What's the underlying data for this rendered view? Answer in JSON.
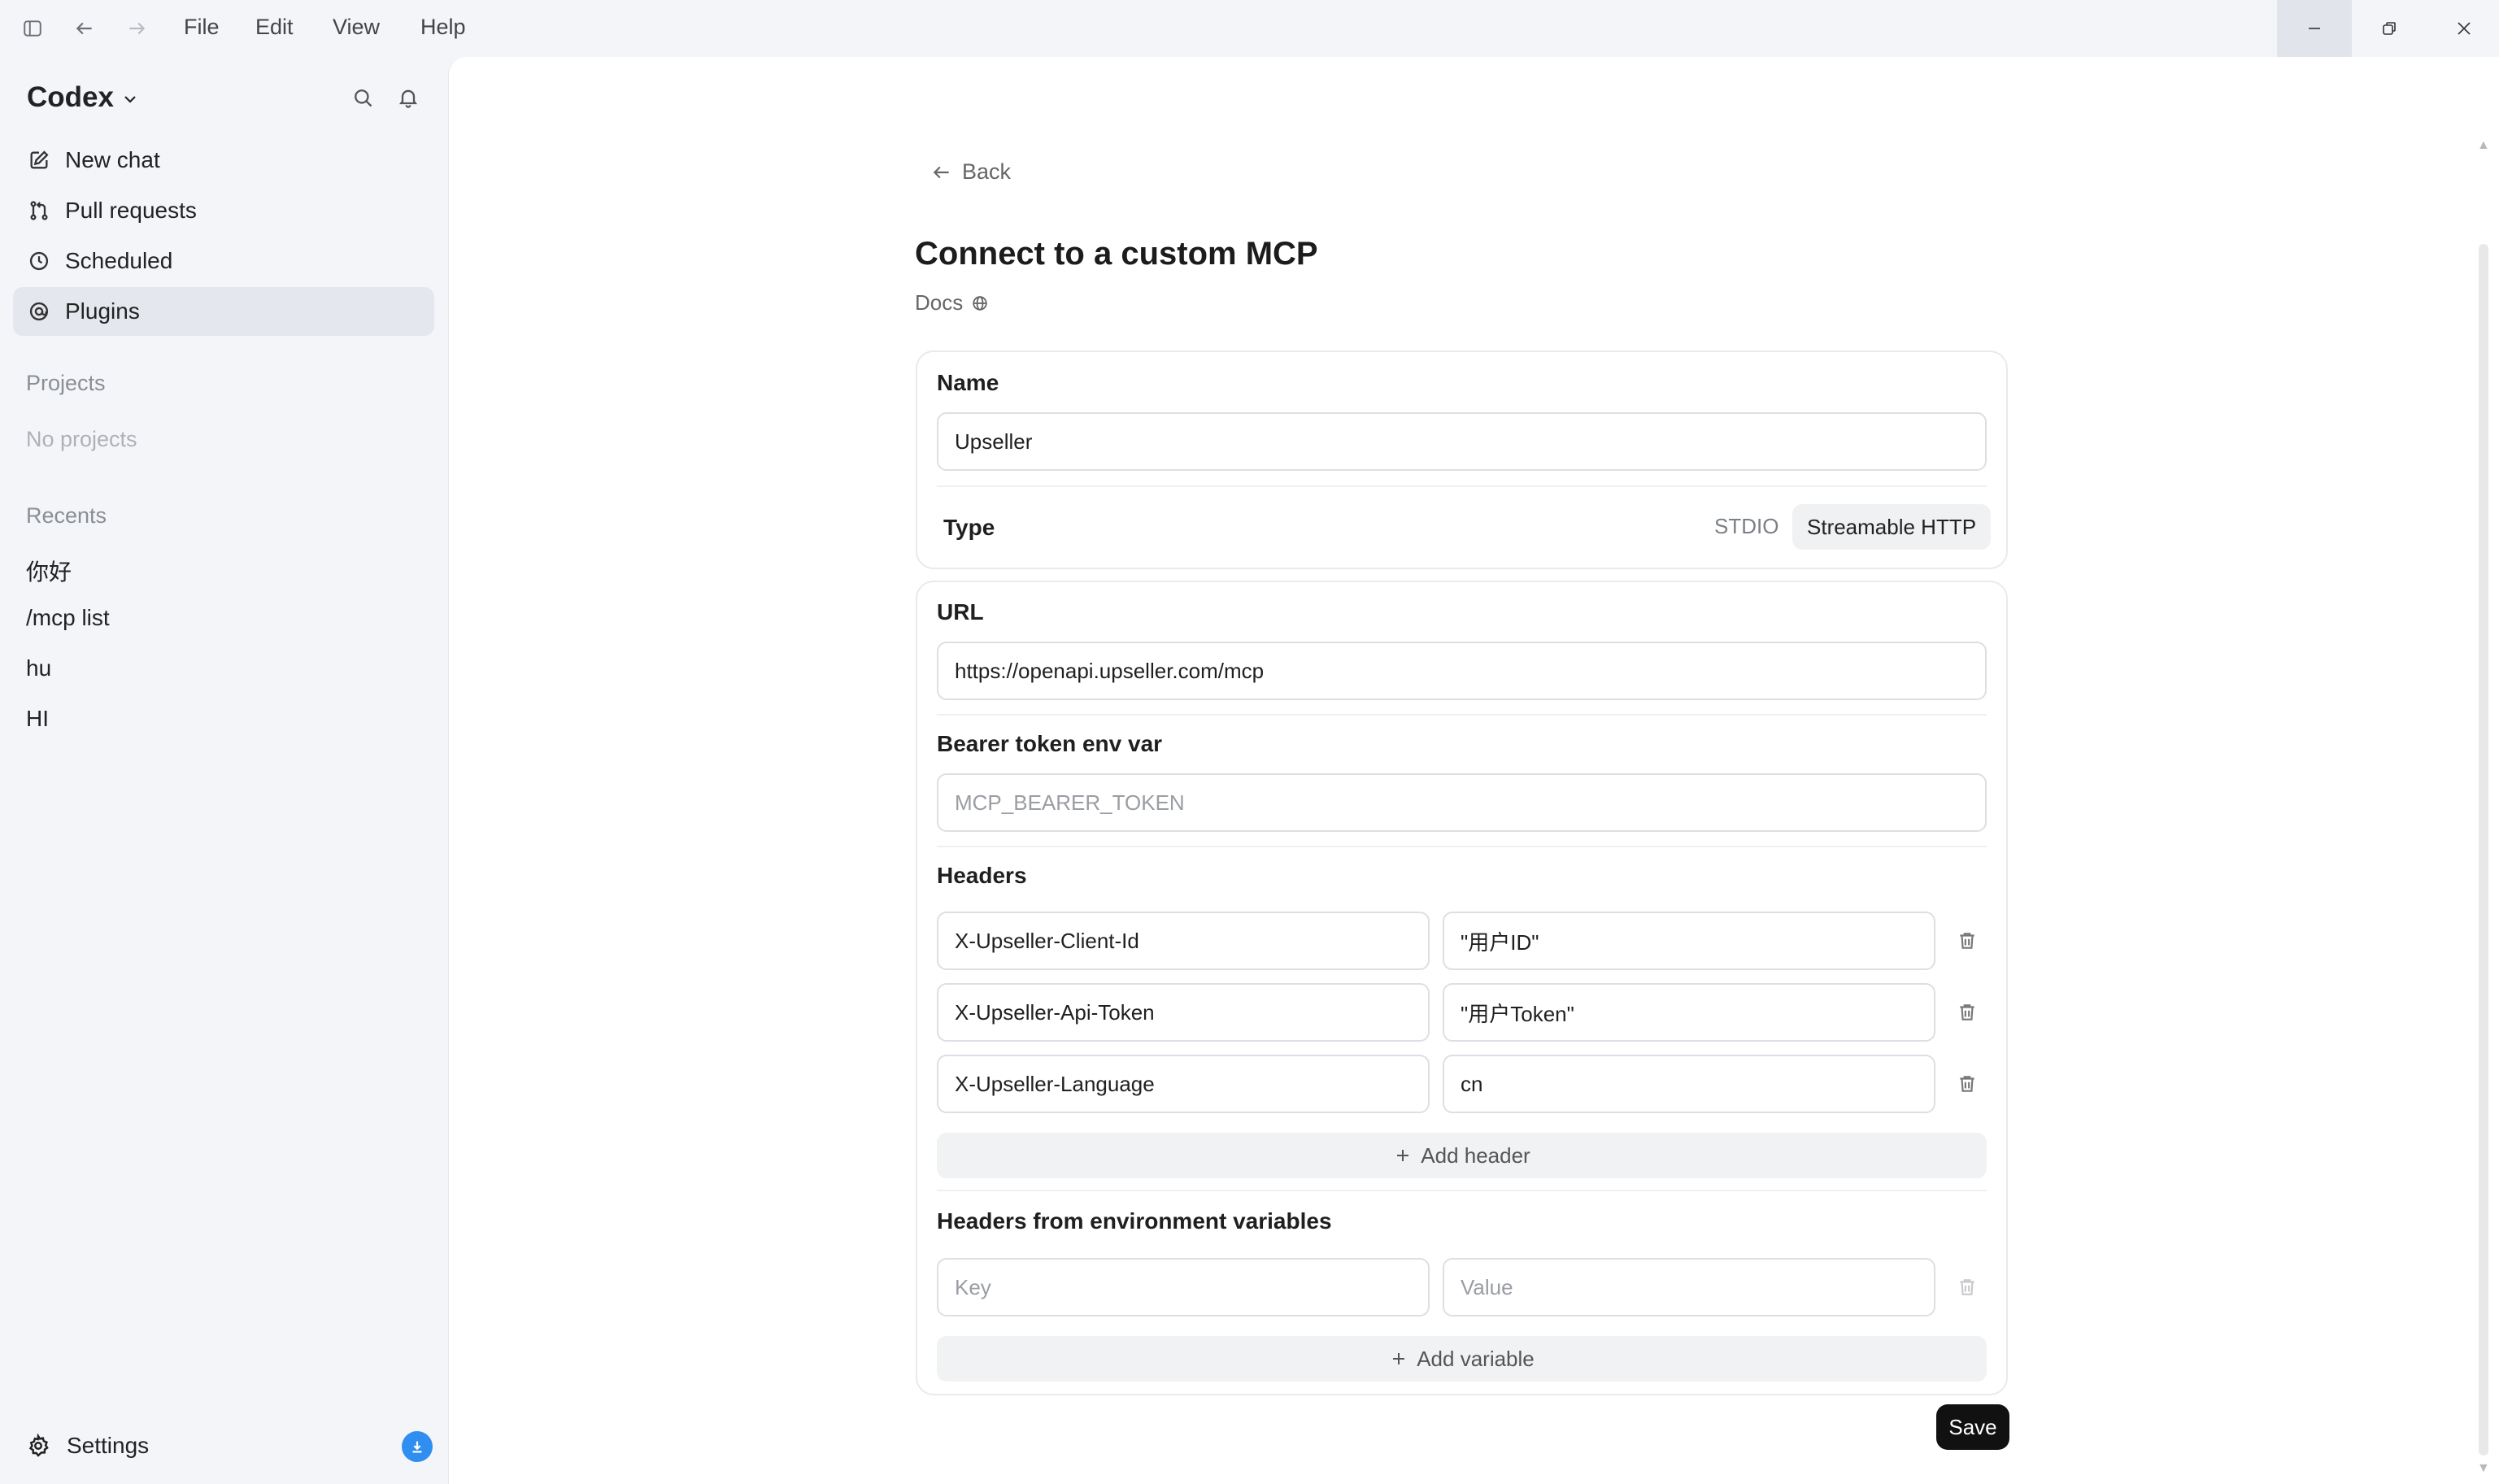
{
  "menu": {
    "file": "File",
    "edit": "Edit",
    "view": "View",
    "help": "Help"
  },
  "sidebar": {
    "brand": "Codex",
    "nav": [
      {
        "label": "New chat"
      },
      {
        "label": "Pull requests"
      },
      {
        "label": "Scheduled"
      },
      {
        "label": "Plugins"
      }
    ],
    "projects_heading": "Projects",
    "projects_empty": "No projects",
    "recents_heading": "Recents",
    "recents": [
      "你好",
      "/mcp list",
      "hu",
      "HI"
    ],
    "settings_label": "Settings"
  },
  "page": {
    "back_label": "Back",
    "title": "Connect to a custom MCP",
    "docs_label": "Docs"
  },
  "form": {
    "name_label": "Name",
    "name_value": "Upseller",
    "type_label": "Type",
    "type_options": [
      "STDIO",
      "Streamable HTTP"
    ],
    "type_selected": "Streamable HTTP",
    "url_label": "URL",
    "url_value": "https://openapi.upseller.com/mcp",
    "bearer_label": "Bearer token env var",
    "bearer_placeholder": "MCP_BEARER_TOKEN",
    "headers_label": "Headers",
    "headers": [
      {
        "key": "X-Upseller-Client-Id",
        "value": "\"用户ID\""
      },
      {
        "key": "X-Upseller-Api-Token",
        "value": "\"用户Token\""
      },
      {
        "key": "X-Upseller-Language",
        "value": "cn"
      }
    ],
    "add_header_label": "Add header",
    "env_headers_label": "Headers from environment variables",
    "env_key_placeholder": "Key",
    "env_value_placeholder": "Value",
    "add_variable_label": "Add variable",
    "save_label": "Save"
  }
}
